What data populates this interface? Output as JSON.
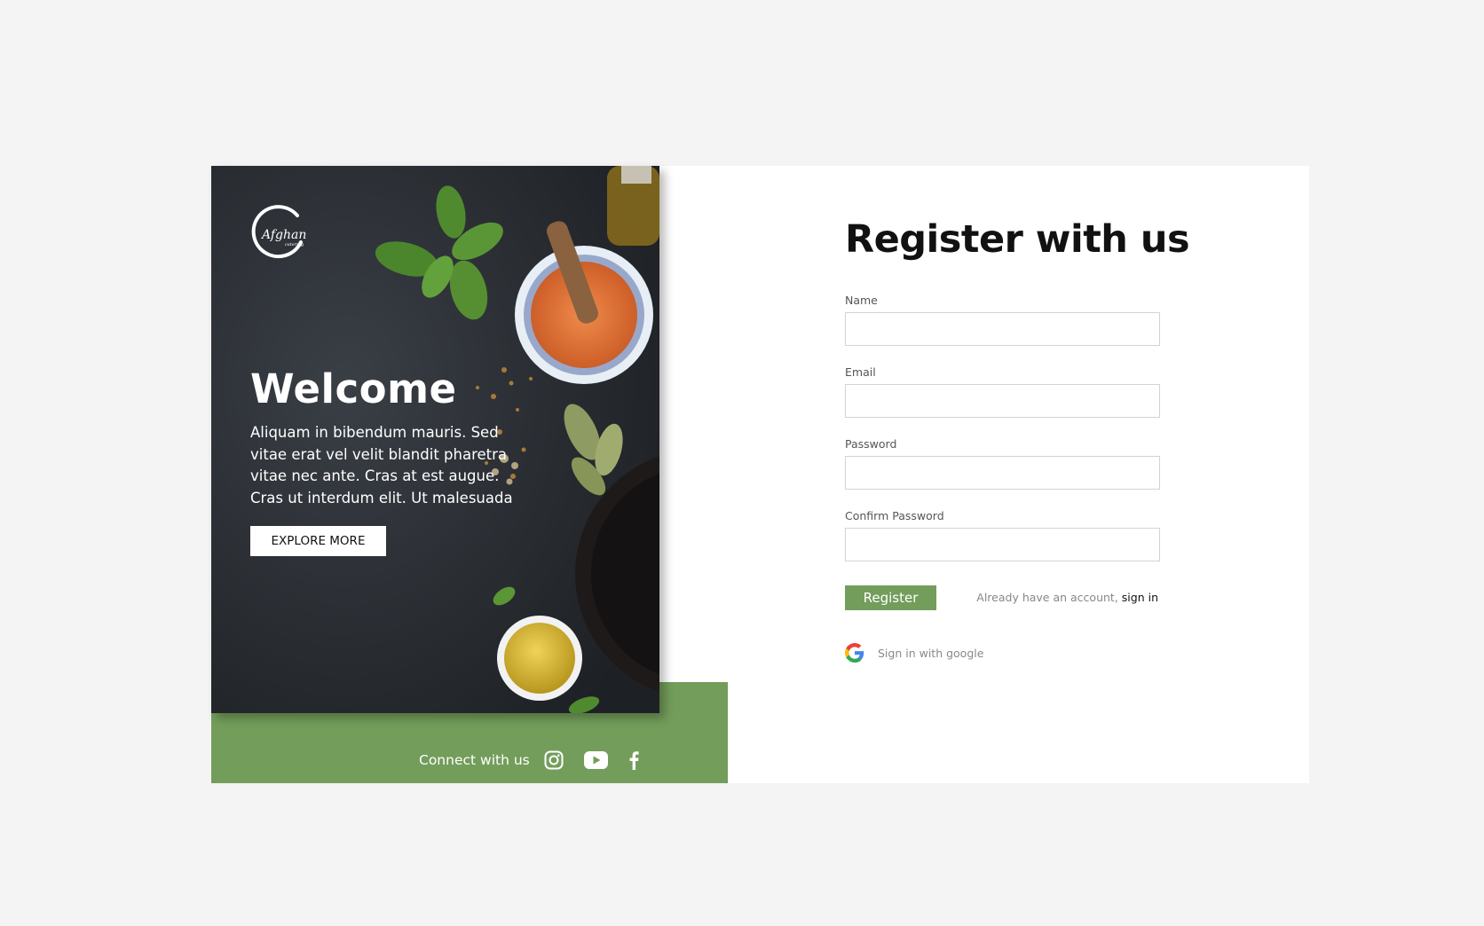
{
  "hero": {
    "logo_text": "Afghan",
    "logo_subtext": "catering",
    "title": "Welcome",
    "intro": "Aliquam in bibendum mauris. Sed vitae erat vel velit blandit pharetra vitae nec ante. Cras at est augue. Cras ut interdum elit. Ut malesuada",
    "explore_label": "EXPLORE MORE"
  },
  "social": {
    "label": "Connect with us",
    "icons": [
      "instagram-icon",
      "youtube-icon",
      "facebook-icon"
    ]
  },
  "form": {
    "title": "Register with us",
    "fields": {
      "name": {
        "label": "Name",
        "value": ""
      },
      "email": {
        "label": "Email",
        "value": ""
      },
      "password": {
        "label": "Password",
        "value": ""
      },
      "confirm": {
        "label": "Confirm Password",
        "value": ""
      }
    },
    "register_label": "Register",
    "have_account_text": "Already have an account, ",
    "signin_link": "sign in",
    "google_text": "Sign in with google"
  },
  "colors": {
    "accent_green": "#739d5b",
    "page_bg": "#f4f4f4",
    "hero_bg": "#2a2e33"
  }
}
